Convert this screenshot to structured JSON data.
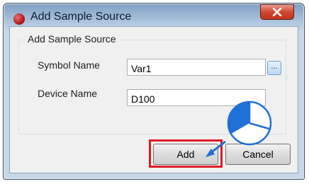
{
  "window": {
    "title": "Add Sample Source"
  },
  "group": {
    "label": "Add Sample Source"
  },
  "fields": [
    {
      "label": "Symbol Name",
      "value": "Var1"
    },
    {
      "label": "Device Name",
      "value": "D100"
    }
  ],
  "browse_label": "...",
  "buttons": {
    "add": "Add",
    "cancel": "Cancel"
  },
  "colors": {
    "highlight": "#e01b24",
    "pointer": "#1f6fd6"
  }
}
